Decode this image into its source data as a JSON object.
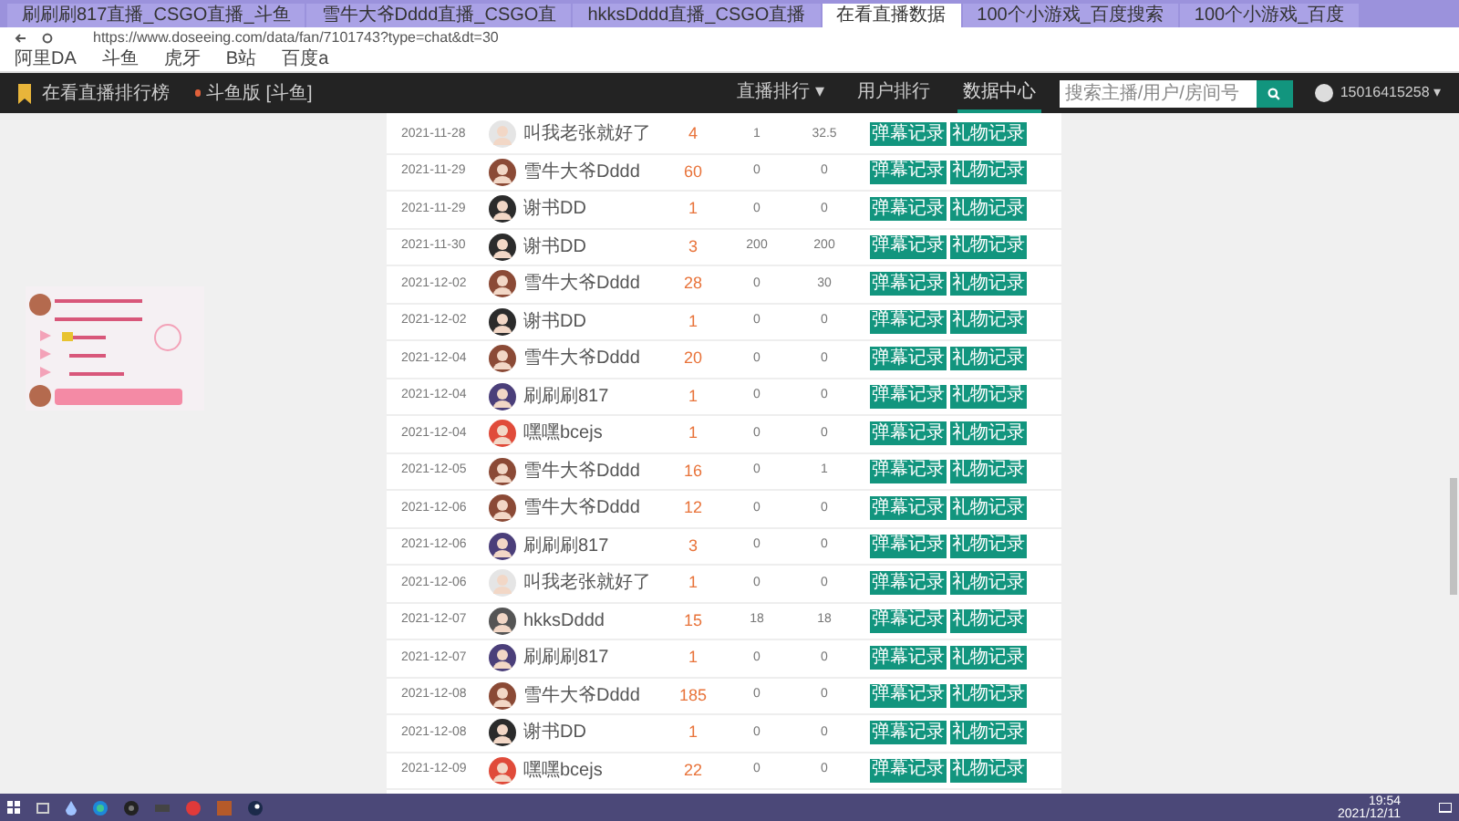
{
  "browser": {
    "tabs": [
      {
        "title": "刷刷刷817直播_CSGO直播_斗鱼",
        "selected": false
      },
      {
        "title": "雪牛大爷Dddd直播_CSGO直",
        "selected": false
      },
      {
        "title": "hkksDddd直播_CSGO直播",
        "selected": false
      },
      {
        "title": "在看直播数据",
        "selected": true
      },
      {
        "title": "100个小游戏_百度搜索",
        "selected": false
      },
      {
        "title": "100个小游戏_百度",
        "selected": false
      }
    ],
    "url": "https://www.doseeing.com/data/fan/7101743?type=chat&dt=30",
    "bookmarks": [
      "阿里DA",
      "斗鱼",
      "虎牙",
      "B站",
      "百度a"
    ]
  },
  "header": {
    "brand": "在看直播排行榜",
    "platform": "斗鱼版 [斗鱼]",
    "nav": [
      {
        "label": "直播排行 ▾",
        "selected": false
      },
      {
        "label": "用户排行",
        "selected": false
      },
      {
        "label": "数据中心",
        "selected": true
      }
    ],
    "search": {
      "placeholder": "搜索主播/用户/房间号"
    },
    "user": "15016415258 ▾"
  },
  "rows": [
    {
      "date": "2021-11-28",
      "name": "叫我老张就好了",
      "color": "#e5e5e5",
      "count": "4",
      "col_4": "1",
      "col_5": "32.5",
      "buttons": [
        "弹幕记录",
        "礼物记录"
      ]
    },
    {
      "date": "2021-11-29",
      "name": "雪牛大爷Dddd",
      "color": "#8b4a36",
      "count": "60",
      "col_4": "0",
      "col_5": "0",
      "buttons": [
        "弹幕记录",
        "礼物记录"
      ]
    },
    {
      "date": "2021-11-29",
      "name": "谢书DD",
      "color": "#2b2b2b",
      "count": "1",
      "col_4": "0",
      "col_5": "0",
      "buttons": [
        "弹幕记录",
        "礼物记录"
      ]
    },
    {
      "date": "2021-11-30",
      "name": "谢书DD",
      "color": "#2b2b2b",
      "count": "3",
      "col_4": "200",
      "col_5": "200",
      "buttons": [
        "弹幕记录",
        "礼物记录"
      ]
    },
    {
      "date": "2021-12-02",
      "name": "雪牛大爷Dddd",
      "color": "#8b4a36",
      "count": "28",
      "col_4": "0",
      "col_5": "30",
      "buttons": [
        "弹幕记录",
        "礼物记录"
      ]
    },
    {
      "date": "2021-12-02",
      "name": "谢书DD",
      "color": "#2b2b2b",
      "count": "1",
      "col_4": "0",
      "col_5": "0",
      "buttons": [
        "弹幕记录",
        "礼物记录"
      ]
    },
    {
      "date": "2021-12-04",
      "name": "雪牛大爷Dddd",
      "color": "#8b4a36",
      "count": "20",
      "col_4": "0",
      "col_5": "0",
      "buttons": [
        "弹幕记录",
        "礼物记录"
      ]
    },
    {
      "date": "2021-12-04",
      "name": "刷刷刷817",
      "color": "#4b3f7a",
      "count": "1",
      "col_4": "0",
      "col_5": "0",
      "buttons": [
        "弹幕记录",
        "礼物记录"
      ]
    },
    {
      "date": "2021-12-04",
      "name": "嘿嘿bcejs",
      "color": "#e04b3a",
      "count": "1",
      "col_4": "0",
      "col_5": "0",
      "buttons": [
        "弹幕记录",
        "礼物记录"
      ]
    },
    {
      "date": "2021-12-05",
      "name": "雪牛大爷Dddd",
      "color": "#8b4a36",
      "count": "16",
      "col_4": "0",
      "col_5": "1",
      "buttons": [
        "弹幕记录",
        "礼物记录"
      ]
    },
    {
      "date": "2021-12-06",
      "name": "雪牛大爷Dddd",
      "color": "#8b4a36",
      "count": "12",
      "col_4": "0",
      "col_5": "0",
      "buttons": [
        "弹幕记录",
        "礼物记录"
      ]
    },
    {
      "date": "2021-12-06",
      "name": "刷刷刷817",
      "color": "#4b3f7a",
      "count": "3",
      "col_4": "0",
      "col_5": "0",
      "buttons": [
        "弹幕记录",
        "礼物记录"
      ]
    },
    {
      "date": "2021-12-06",
      "name": "叫我老张就好了",
      "color": "#e5e5e5",
      "count": "1",
      "col_4": "0",
      "col_5": "0",
      "buttons": [
        "弹幕记录",
        "礼物记录"
      ]
    },
    {
      "date": "2021-12-07",
      "name": "hkksDddd",
      "color": "#555555",
      "count": "15",
      "col_4": "18",
      "col_5": "18",
      "buttons": [
        "弹幕记录",
        "礼物记录"
      ]
    },
    {
      "date": "2021-12-07",
      "name": "刷刷刷817",
      "color": "#4b3f7a",
      "count": "1",
      "col_4": "0",
      "col_5": "0",
      "buttons": [
        "弹幕记录",
        "礼物记录"
      ]
    },
    {
      "date": "2021-12-08",
      "name": "雪牛大爷Dddd",
      "color": "#8b4a36",
      "count": "185",
      "col_4": "0",
      "col_5": "0",
      "buttons": [
        "弹幕记录",
        "礼物记录"
      ]
    },
    {
      "date": "2021-12-08",
      "name": "谢书DD",
      "color": "#2b2b2b",
      "count": "1",
      "col_4": "0",
      "col_5": "0",
      "buttons": [
        "弹幕记录",
        "礼物记录"
      ]
    },
    {
      "date": "2021-12-09",
      "name": "嘿嘿bcejs",
      "color": "#e04b3a",
      "count": "22",
      "col_4": "0",
      "col_5": "0",
      "buttons": [
        "弹幕记录",
        "礼物记录"
      ]
    }
  ],
  "taskbar": {
    "time": "19:54",
    "date": "2021/12/11"
  }
}
